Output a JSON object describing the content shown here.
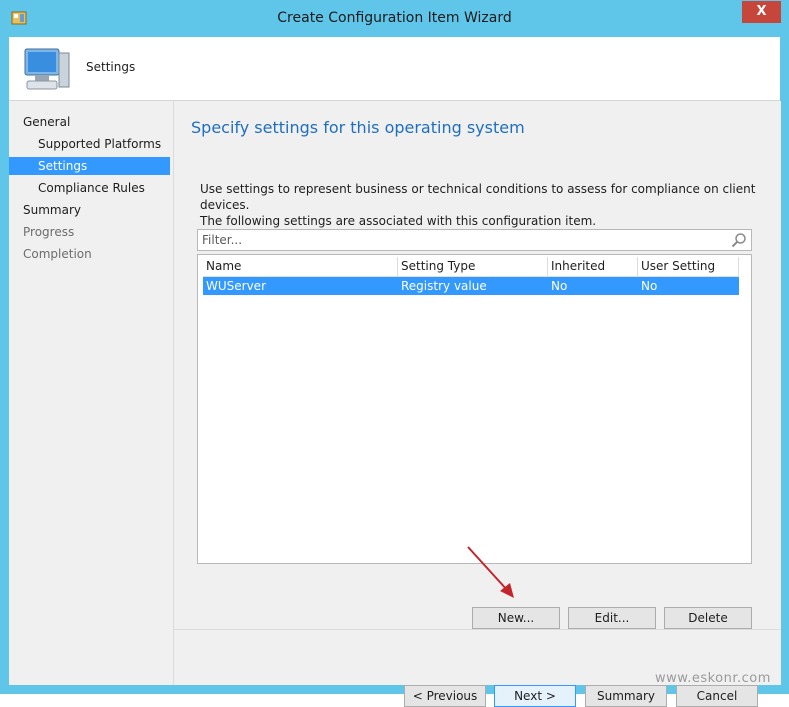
{
  "window": {
    "title": "Create Configuration Item Wizard",
    "close_label": "X"
  },
  "header": {
    "label": "Settings"
  },
  "nav": {
    "items": [
      {
        "label": "General",
        "level": "top",
        "state": "normal"
      },
      {
        "label": "Supported Platforms",
        "level": "sub",
        "state": "normal"
      },
      {
        "label": "Settings",
        "level": "sub",
        "state": "selected"
      },
      {
        "label": "Compliance Rules",
        "level": "sub",
        "state": "normal"
      },
      {
        "label": "Summary",
        "level": "top",
        "state": "normal"
      },
      {
        "label": "Progress",
        "level": "top",
        "state": "disabled"
      },
      {
        "label": "Completion",
        "level": "top",
        "state": "disabled"
      }
    ]
  },
  "main": {
    "heading": "Specify settings for this operating system",
    "description_line1": "Use settings to represent business or technical conditions to assess for compliance on client devices.",
    "description_line2": "The following settings are associated with this configuration item.",
    "filter": {
      "placeholder": "Filter...",
      "value": ""
    },
    "table": {
      "columns": [
        "Name",
        "Setting Type",
        "Inherited",
        "User Setting"
      ],
      "rows": [
        [
          "WUServer",
          "Registry value",
          "No",
          "No"
        ]
      ]
    },
    "actions": {
      "new": "New...",
      "edit": "Edit...",
      "delete": "Delete"
    }
  },
  "footer": {
    "previous": "< Previous",
    "next": "Next >",
    "summary": "Summary",
    "cancel": "Cancel"
  },
  "watermark": "www.eskonr.com",
  "colors": {
    "titlebar": "#5fc6ea",
    "selection": "#3399ff",
    "heading": "#1f6fbd",
    "close": "#c7463b",
    "arrow": "#c0262c"
  }
}
